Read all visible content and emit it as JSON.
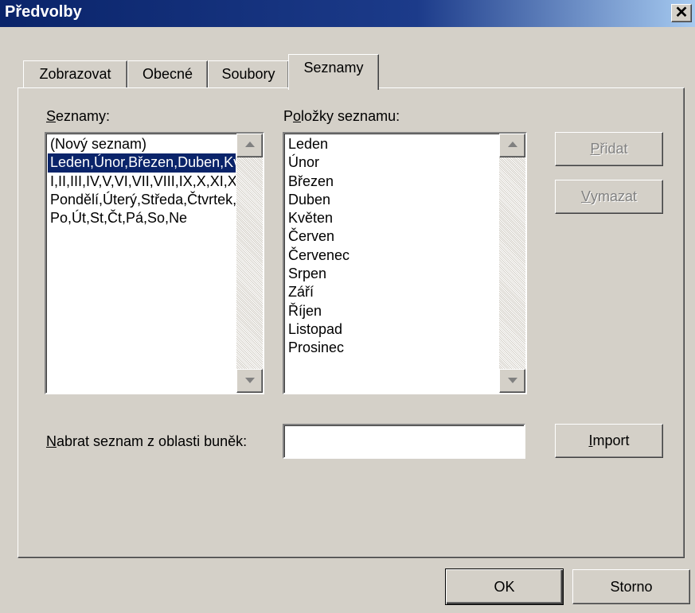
{
  "window": {
    "title": "Předvolby",
    "close_glyph": "✕"
  },
  "tabs": [
    {
      "label": "Zobrazovat",
      "active": false
    },
    {
      "label": "Obecné",
      "active": false
    },
    {
      "label": "Soubory",
      "active": false
    },
    {
      "label": "Seznamy",
      "active": true
    }
  ],
  "lists_label": {
    "mnemonic": "S",
    "rest": "eznamy:"
  },
  "items_label": {
    "pre": "P",
    "mnemonic": "o",
    "rest": "ložky seznamu:"
  },
  "lists": {
    "items": [
      "(Nový seznam)",
      "Leden,Únor,Březen,Duben,Květen,Červen,Červenec,Srpen,Září,Říjen,Listopad,Prosinec",
      "I,II,III,IV,V,VI,VII,VIII,IX,X,XI,XII",
      "Pondělí,Úterý,Středa,Čtvrtek,Pátek,Sobota,Neděle",
      "Po,Út,St,Čt,Pá,So,Ne"
    ],
    "selected_index": 1
  },
  "entries": {
    "items": [
      "Leden",
      "Únor",
      "Březen",
      "Duben",
      "Květen",
      "Červen",
      "Červenec",
      "Srpen",
      "Září",
      "Říjen",
      "Listopad",
      "Prosinec"
    ]
  },
  "buttons": {
    "add": {
      "mnemonic": "P",
      "rest": "řidat"
    },
    "delete": {
      "mnemonic": "V",
      "rest": "ymazat"
    },
    "import": {
      "mnemonic": "I",
      "rest": "mport"
    },
    "ok": "OK",
    "cancel": "Storno"
  },
  "range_label": {
    "mnemonic": "N",
    "rest": "abrat seznam z oblasti buněk:"
  },
  "range_input": {
    "value": ""
  },
  "icons": {
    "scroll_up": "scroll-up-arrow-icon",
    "scroll_down": "scroll-down-arrow-icon",
    "close": "close-icon"
  },
  "colors": {
    "titlebar": "#0a246a",
    "face": "#d4d0c8",
    "selection": "#0a246a"
  }
}
